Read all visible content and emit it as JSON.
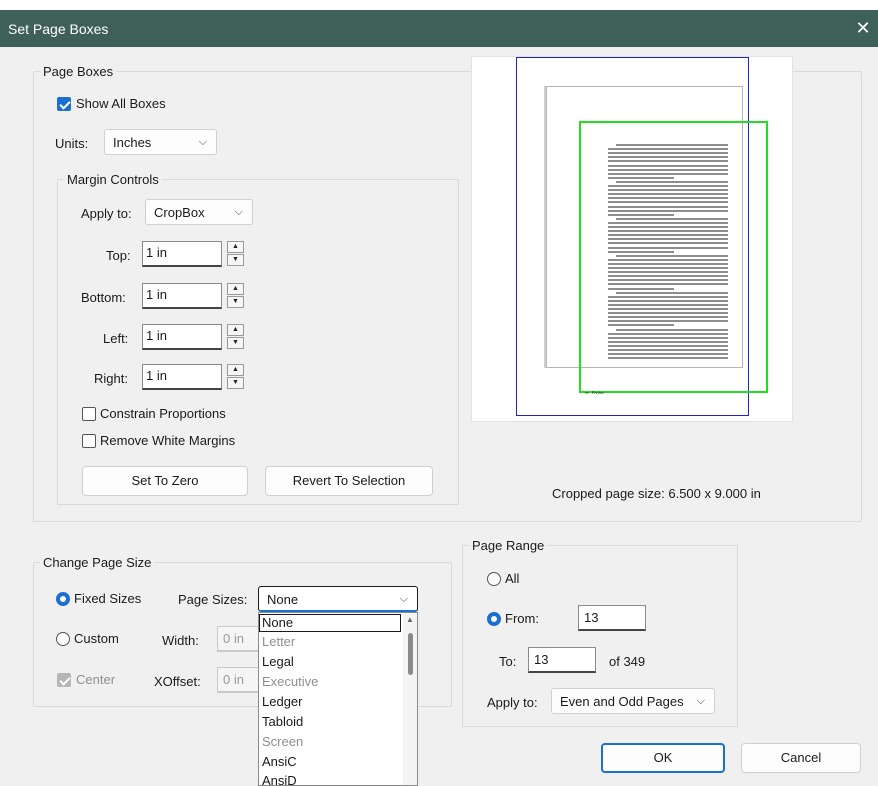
{
  "window": {
    "title": "Set Page Boxes",
    "close_glyph": "✕"
  },
  "page_boxes": {
    "legend": "Page Boxes",
    "show_all_boxes": {
      "label": "Show All Boxes",
      "checked": true
    },
    "units": {
      "label": "Units:",
      "value": "Inches"
    },
    "margin_controls": {
      "legend": "Margin Controls",
      "apply_to": {
        "label": "Apply to:",
        "value": "CropBox"
      },
      "top": {
        "label": "Top:",
        "value": "1 in"
      },
      "bottom": {
        "label": "Bottom:",
        "value": "1 in"
      },
      "left": {
        "label": "Left:",
        "value": "1 in"
      },
      "right": {
        "label": "Right:",
        "value": "1 in"
      },
      "constrain_proportions": {
        "label": "Constrain Proportions",
        "checked": false
      },
      "remove_white_margins": {
        "label": "Remove White Margins",
        "checked": false
      },
      "set_to_zero": "Set To Zero",
      "revert_to_selection": "Revert To Selection"
    },
    "cropped_page_size": "Cropped page size: 6.500 x 9.000 in"
  },
  "change_page_size": {
    "legend": "Change Page Size",
    "fixed_sizes": {
      "label": "Fixed Sizes",
      "selected": true
    },
    "page_sizes": {
      "label": "Page Sizes:",
      "value": "None"
    },
    "custom": {
      "label": "Custom",
      "selected": false
    },
    "width": {
      "label": "Width:",
      "value": "0 in"
    },
    "center": {
      "label": "Center",
      "checked": true
    },
    "xoffset": {
      "label": "XOffset:",
      "value": "0 in"
    },
    "dropdown_options": [
      {
        "label": "None",
        "enabled": true,
        "selected": true
      },
      {
        "label": "Letter",
        "enabled": false
      },
      {
        "label": "Legal",
        "enabled": true
      },
      {
        "label": "Executive",
        "enabled": false
      },
      {
        "label": "Ledger",
        "enabled": true
      },
      {
        "label": "Tabloid",
        "enabled": true
      },
      {
        "label": "Screen",
        "enabled": false
      },
      {
        "label": "AnsiC",
        "enabled": true
      },
      {
        "label": "AnsiD",
        "enabled": true
      }
    ]
  },
  "page_range": {
    "legend": "Page Range",
    "all": {
      "label": "All",
      "selected": false
    },
    "from": {
      "label": "From:",
      "value": "13",
      "selected": true
    },
    "to": {
      "label": "To:",
      "value": "13"
    },
    "of_total": "of 349",
    "apply_to": {
      "label": "Apply to:",
      "value": "Even and Odd Pages"
    }
  },
  "buttons": {
    "ok": "OK",
    "cancel": "Cancel"
  },
  "preview_text": {
    "footer_left": "xv",
    "footer_right": "Preface"
  },
  "colors": {
    "titlebar": "#3f6059",
    "accent": "#1a6fd3",
    "mediabox": "#2222cc",
    "cropbox": "#22dd22"
  }
}
